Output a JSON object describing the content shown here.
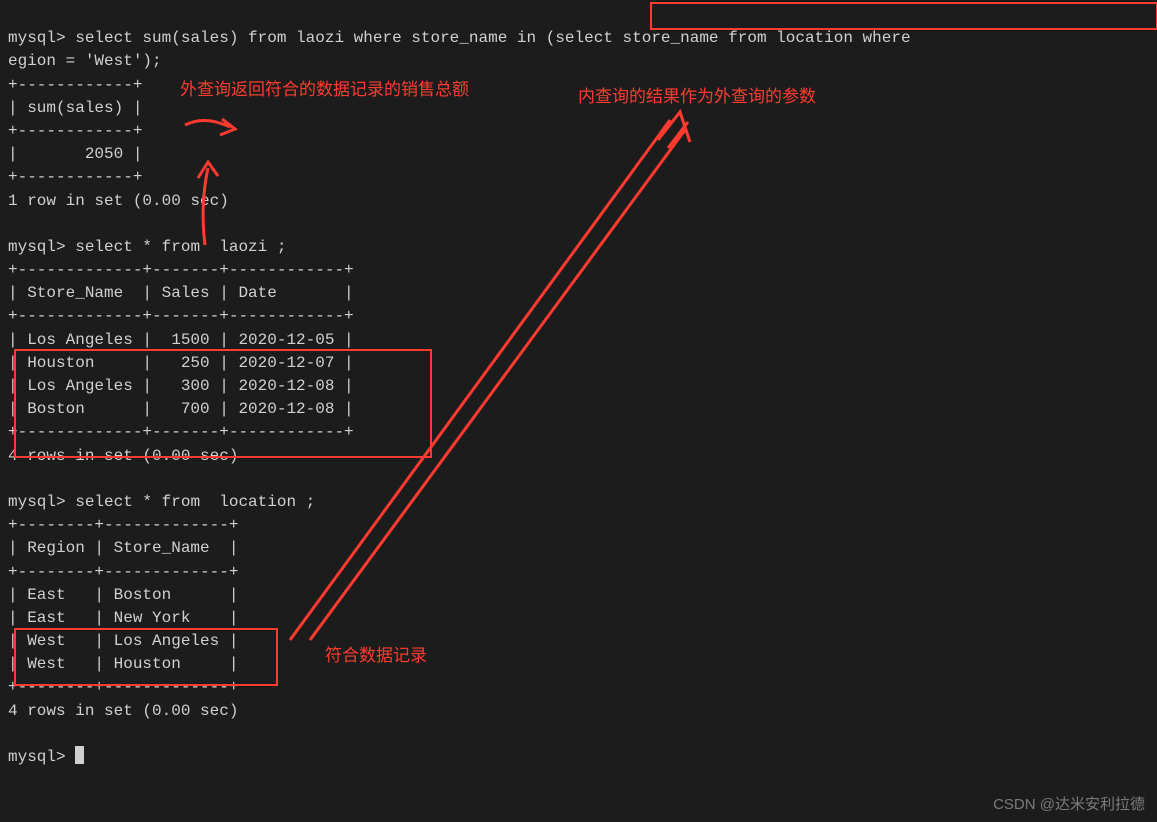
{
  "query1": {
    "prompt": "mysql> ",
    "sql_part1": "select sum(sales) from laozi where store_name in ",
    "sql_sub": "(select store_name from location where ",
    "sql_line2": "egion = 'West');",
    "border_top": "+------------+",
    "header": "| sum(sales) |",
    "border_mid": "+------------+",
    "row": "|       2050 |",
    "border_bot": "+------------+",
    "rowcount": "1 row in set (0.00 sec)"
  },
  "query2": {
    "prompt": "mysql> ",
    "sql": "select * from  laozi ;",
    "border": "+-------------+-------+------------+",
    "header": "| Store_Name  | Sales | Date       |",
    "rows": [
      "| Los Angeles |  1500 | 2020-12-05 |",
      "| Houston     |   250 | 2020-12-07 |",
      "| Los Angeles |   300 | 2020-12-08 |",
      "| Boston      |   700 | 2020-12-08 |"
    ],
    "rowcount": "4 rows in set (0.00 sec)"
  },
  "query3": {
    "prompt": "mysql> ",
    "sql": "select * from  location ;",
    "border": "+--------+-------------+",
    "header": "| Region | Store_Name  |",
    "rows": [
      "| East   | Boston      |",
      "| East   | New York    |",
      "| West   | Los Angeles |",
      "| West   | Houston     |"
    ],
    "rowcount": "4 rows in set (0.00 sec)"
  },
  "final_prompt": "mysql> ",
  "annotations": {
    "a1": "外查询返回符合的数据记录的销售总额",
    "a2": "内查询的结果作为外查询的参数",
    "a3": "符合数据记录"
  },
  "watermark": "CSDN @达米安利拉德"
}
